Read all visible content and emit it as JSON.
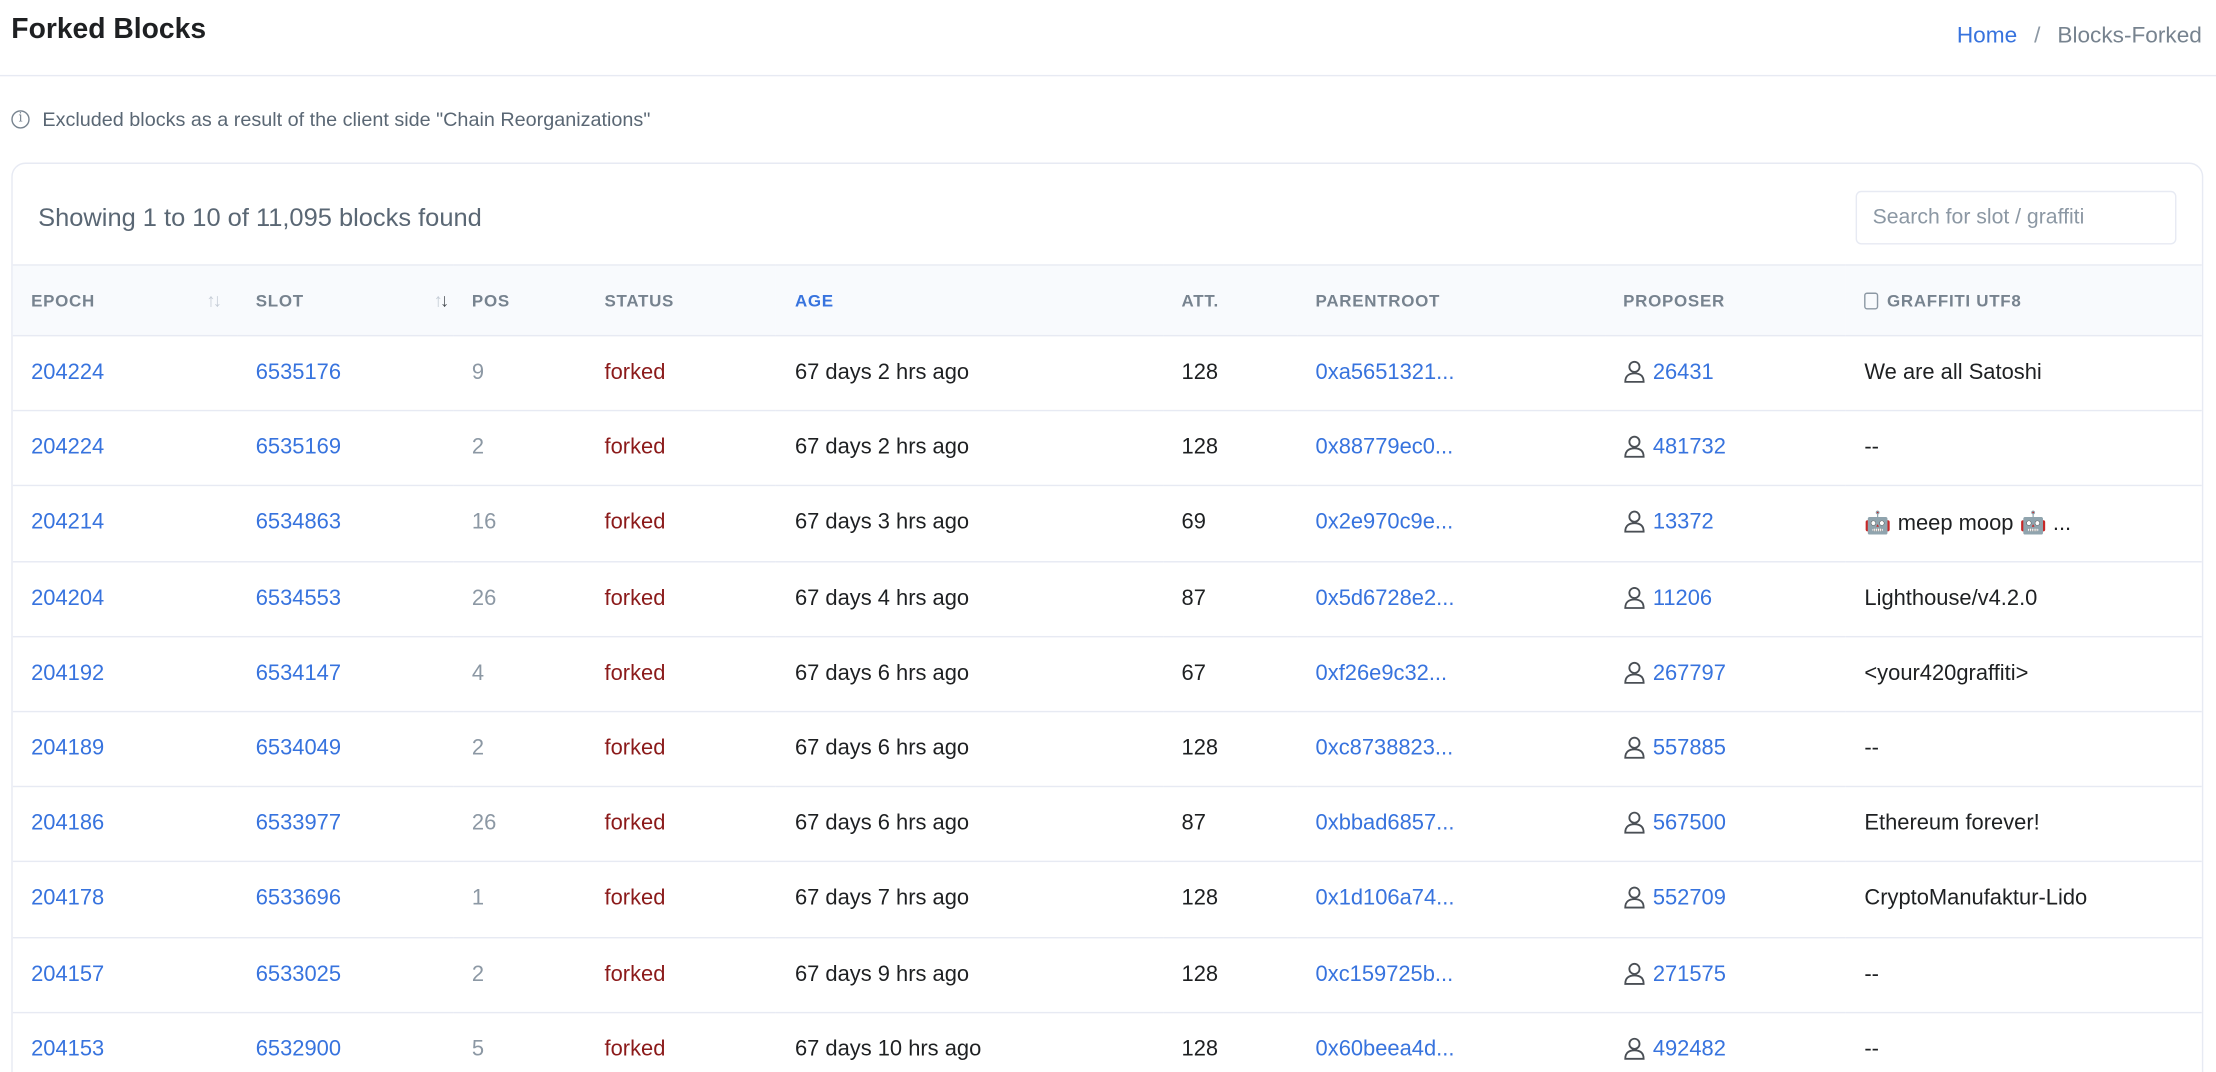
{
  "header": {
    "title": "Forked Blocks"
  },
  "breadcrumb": {
    "home": "Home",
    "separator": "/",
    "current": "Blocks-Forked"
  },
  "info": {
    "icon": "info-circle-icon",
    "text": "Excluded blocks as a result of the client side \"Chain Reorganizations\""
  },
  "summary": {
    "showing": "Showing 1 to 10 of 11,095 blocks found"
  },
  "search": {
    "placeholder": "Search for slot / graffiti"
  },
  "columns": {
    "epoch": "EPOCH",
    "slot": "SLOT",
    "pos": "POS",
    "status": "STATUS",
    "age": "AGE",
    "att": "ATT.",
    "parentroot": "PARENTROOT",
    "proposer": "PROPOSER",
    "graffiti": "GRAFFITI UTF8"
  },
  "colors": {
    "link": "#3773de",
    "status_forked": "#8b1a1a",
    "muted": "#8c98a4"
  },
  "rows": [
    {
      "epoch": "204224",
      "slot": "6535176",
      "pos": "9",
      "status": "forked",
      "age": "67 days 2 hrs ago",
      "att": "128",
      "parentroot": "0xa5651321...",
      "proposer": "26431",
      "graffiti": "We are all Satoshi"
    },
    {
      "epoch": "204224",
      "slot": "6535169",
      "pos": "2",
      "status": "forked",
      "age": "67 days 2 hrs ago",
      "att": "128",
      "parentroot": "0x88779ec0...",
      "proposer": "481732",
      "graffiti": "--"
    },
    {
      "epoch": "204214",
      "slot": "6534863",
      "pos": "16",
      "status": "forked",
      "age": "67 days 3 hrs ago",
      "att": "69",
      "parentroot": "0x2e970c9e...",
      "proposer": "13372",
      "graffiti": "🤖 meep moop 🤖 ..."
    },
    {
      "epoch": "204204",
      "slot": "6534553",
      "pos": "26",
      "status": "forked",
      "age": "67 days 4 hrs ago",
      "att": "87",
      "parentroot": "0x5d6728e2...",
      "proposer": "11206",
      "graffiti": "Lighthouse/v4.2.0"
    },
    {
      "epoch": "204192",
      "slot": "6534147",
      "pos": "4",
      "status": "forked",
      "age": "67 days 6 hrs ago",
      "att": "67",
      "parentroot": "0xf26e9c32...",
      "proposer": "267797",
      "graffiti": "<your420graffiti>"
    },
    {
      "epoch": "204189",
      "slot": "6534049",
      "pos": "2",
      "status": "forked",
      "age": "67 days 6 hrs ago",
      "att": "128",
      "parentroot": "0xc8738823...",
      "proposer": "557885",
      "graffiti": "--"
    },
    {
      "epoch": "204186",
      "slot": "6533977",
      "pos": "26",
      "status": "forked",
      "age": "67 days 6 hrs ago",
      "att": "87",
      "parentroot": "0xbbad6857...",
      "proposer": "567500",
      "graffiti": "Ethereum forever!"
    },
    {
      "epoch": "204178",
      "slot": "6533696",
      "pos": "1",
      "status": "forked",
      "age": "67 days 7 hrs ago",
      "att": "128",
      "parentroot": "0x1d106a74...",
      "proposer": "552709",
      "graffiti": "CryptoManufaktur-Lido"
    },
    {
      "epoch": "204157",
      "slot": "6533025",
      "pos": "2",
      "status": "forked",
      "age": "67 days 9 hrs ago",
      "att": "128",
      "parentroot": "0xc159725b...",
      "proposer": "271575",
      "graffiti": "--"
    },
    {
      "epoch": "204153",
      "slot": "6532900",
      "pos": "5",
      "status": "forked",
      "age": "67 days 10 hrs ago",
      "att": "128",
      "parentroot": "0x60beea4d...",
      "proposer": "492482",
      "graffiti": "--"
    }
  ]
}
